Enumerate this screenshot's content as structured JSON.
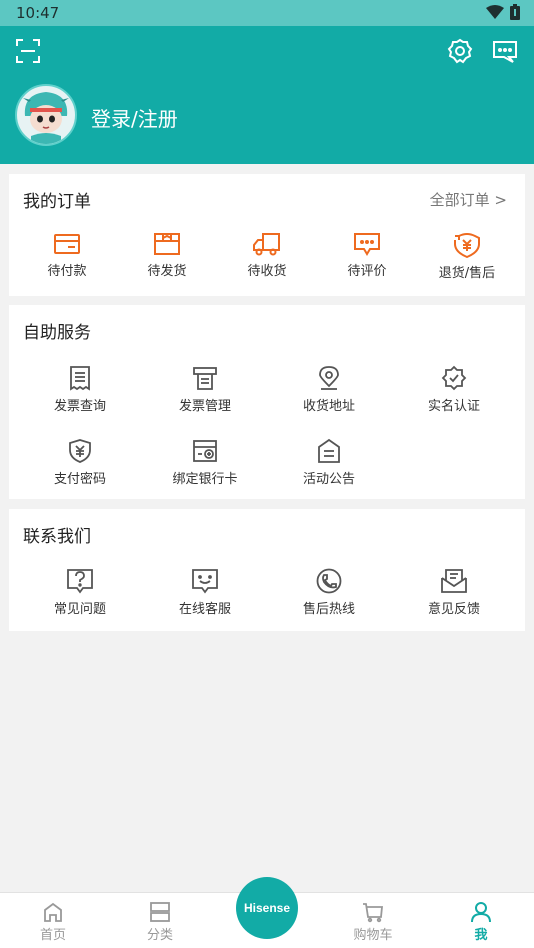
{
  "status_bar": {
    "time": "10:47"
  },
  "header": {
    "login_text": "登录/注册"
  },
  "orders": {
    "title": "我的订单",
    "all_link": "全部订单 >",
    "items": [
      {
        "label": "待付款",
        "icon": "wallet-icon"
      },
      {
        "label": "待发货",
        "icon": "package-icon"
      },
      {
        "label": "待收货",
        "icon": "truck-icon"
      },
      {
        "label": "待评价",
        "icon": "comment-icon"
      },
      {
        "label": "退货/售后",
        "icon": "refund-icon"
      }
    ]
  },
  "self_service": {
    "title": "自助服务",
    "items": [
      {
        "label": "发票查询",
        "icon": "receipt-icon"
      },
      {
        "label": "发票管理",
        "icon": "printer-icon"
      },
      {
        "label": "收货地址",
        "icon": "location-icon"
      },
      {
        "label": "实名认证",
        "icon": "verified-badge-icon"
      },
      {
        "label": "支付密码",
        "icon": "shield-yen-icon"
      },
      {
        "label": "绑定银行卡",
        "icon": "add-card-icon"
      },
      {
        "label": "活动公告",
        "icon": "announcement-icon"
      }
    ]
  },
  "contact": {
    "title": "联系我们",
    "items": [
      {
        "label": "常见问题",
        "icon": "question-icon"
      },
      {
        "label": "在线客服",
        "icon": "chat-smile-icon"
      },
      {
        "label": "售后热线",
        "icon": "phone-icon"
      },
      {
        "label": "意见反馈",
        "icon": "feedback-mail-icon"
      }
    ]
  },
  "tab_bar": {
    "tabs": [
      {
        "label": "首页",
        "icon": "home-icon"
      },
      {
        "label": "分类",
        "icon": "category-icon"
      },
      {
        "label": "购物车",
        "icon": "cart-icon"
      },
      {
        "label": "我",
        "icon": "user-icon"
      }
    ],
    "center_logo": "Hisense",
    "active": "我"
  },
  "colors": {
    "brand": "#12aba6",
    "status_bar": "#5cc7c2",
    "order_icon": "#ee6a1f",
    "icon_gray": "#555555"
  }
}
